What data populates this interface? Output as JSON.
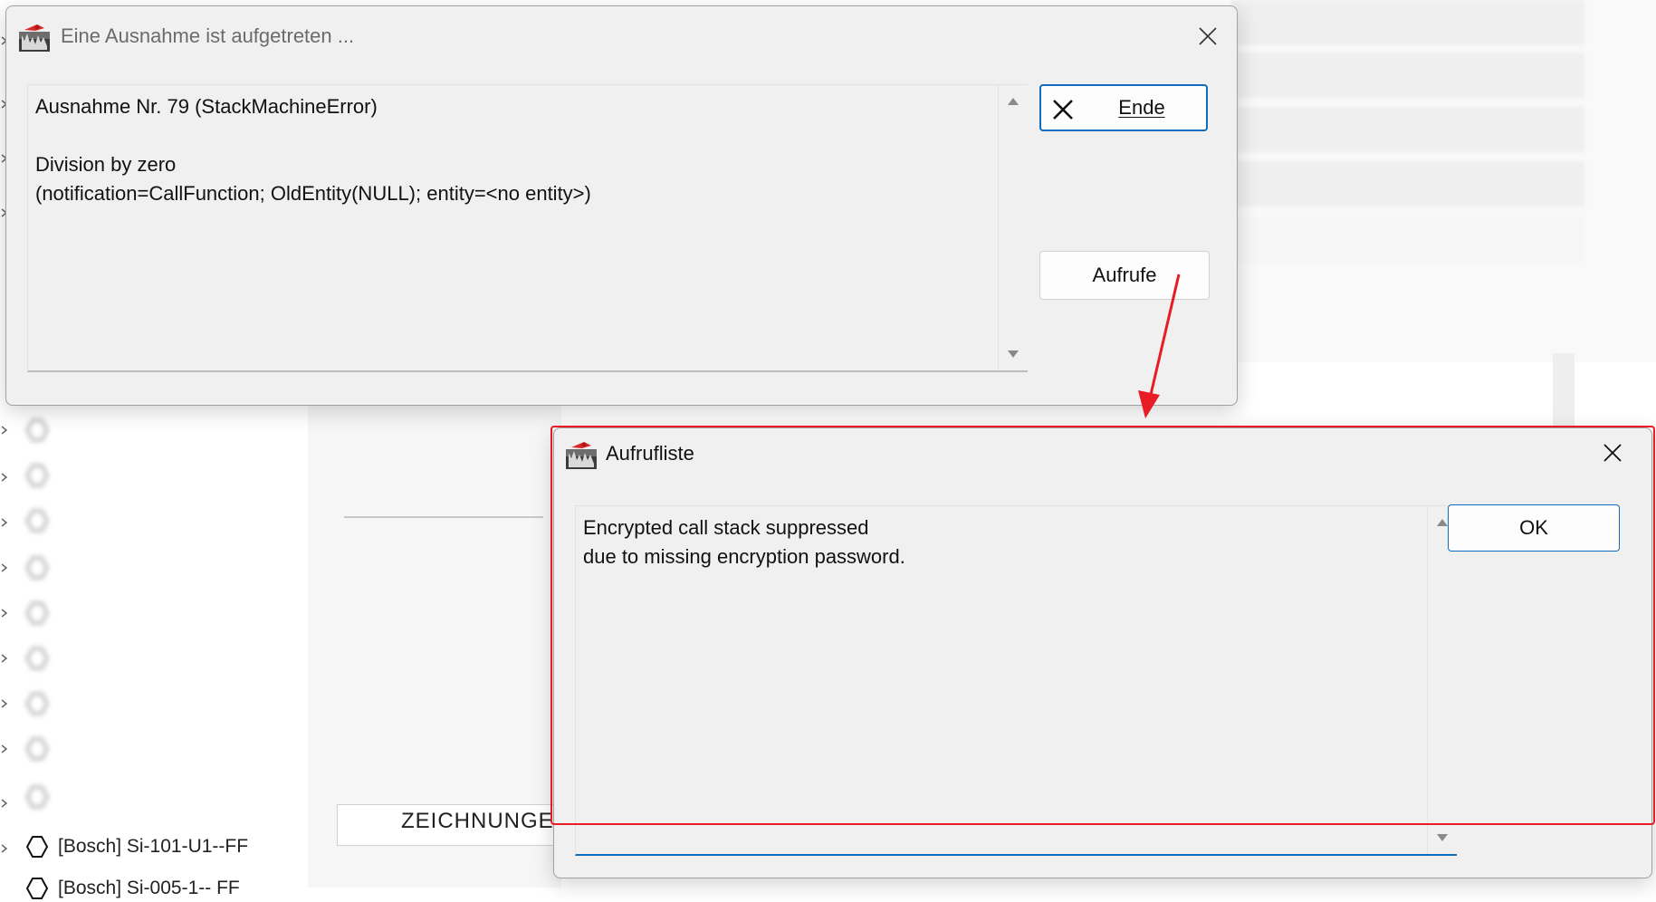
{
  "background": {
    "tree_items": [
      {
        "label": "[Bosch] Si-101-U1--FF"
      },
      {
        "label": "[Bosch] Si-005-1-- FF"
      }
    ],
    "tab_label": "ZEICHNUNGEN"
  },
  "exception_dialog": {
    "title": "Eine Ausnahme ist aufgetreten ...",
    "message": "Ausnahme Nr. 79 (StackMachineError)\n\nDivision by zero\n(notification=CallFunction; OldEntity(NULL); entity=<no entity>)",
    "end_button_label": "Ende",
    "calls_button_label": "Aufrufe",
    "icons": {
      "app": "app-icon",
      "close": "close-icon",
      "end": "x-icon"
    }
  },
  "call_list_dialog": {
    "title": "Aufrufliste",
    "message": "Encrypted call stack suppressed\ndue to missing encryption password.",
    "ok_button_label": "OK",
    "icons": {
      "app": "app-icon",
      "close": "close-icon"
    }
  },
  "colors": {
    "highlight_box": "#e81c24",
    "focus_accent": "#0f6cbd",
    "dialog_bg": "#f0f0f0"
  }
}
